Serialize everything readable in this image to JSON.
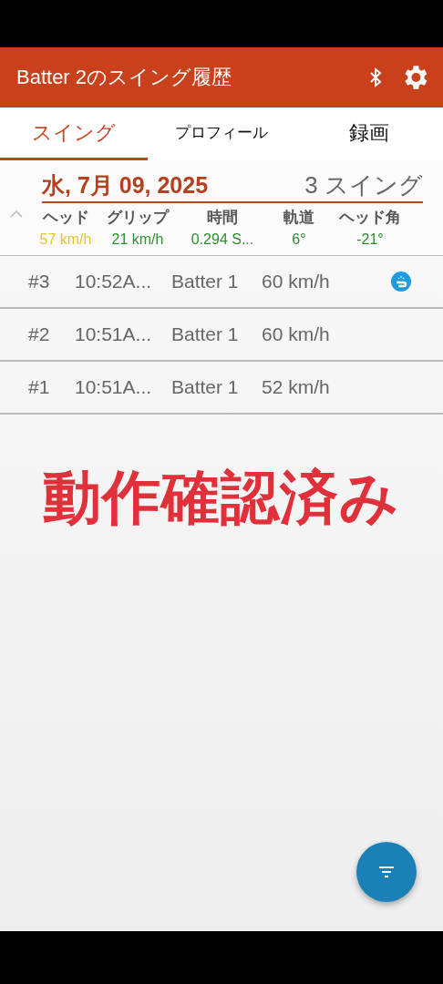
{
  "app_bar": {
    "title": "Batter 2のスイング履歴"
  },
  "tabs": [
    {
      "label": "スイング",
      "selected": true
    },
    {
      "label": "プロフィール",
      "selected": false
    },
    {
      "label": "録画",
      "selected": false
    }
  ],
  "group": {
    "date": "水, 7月 09, 2025",
    "count": "3 スイング",
    "expanded": true,
    "stats": [
      {
        "label": "ヘッド",
        "value": "57 km/h",
        "color": "#e6c62a"
      },
      {
        "label": "グリップ",
        "value": "21 km/h",
        "color": "#2f8f2f"
      },
      {
        "label": "時間",
        "value": "0.294 S...",
        "color": "#2f8f2f"
      },
      {
        "label": "軌道",
        "value": "6°",
        "color": "#2f8f2f"
      },
      {
        "label": "ヘッド角",
        "value": "-21°",
        "color": "#2f8f2f"
      }
    ]
  },
  "swings": [
    {
      "number": "#3",
      "time": "10:52A...",
      "batter": "Batter 1",
      "speed": "60 km/h",
      "marked": true
    },
    {
      "number": "#2",
      "time": "10:51A...",
      "batter": "Batter 1",
      "speed": "60 km/h",
      "marked": false
    },
    {
      "number": "#1",
      "time": "10:51A...",
      "batter": "Batter 1",
      "speed": "52 km/h",
      "marked": false
    }
  ],
  "overlay_text": "動作確認済み"
}
